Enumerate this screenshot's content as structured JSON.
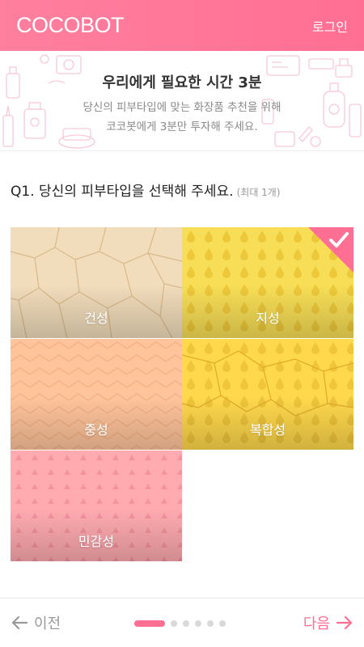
{
  "header": {
    "logo": "COCOBOT",
    "login_label": "로그인"
  },
  "banner": {
    "title": "우리에게 필요한 시간 3분",
    "subtitle_line1": "당신의 피부타입에 맞는 화장품 추천을 위해",
    "subtitle_line2": "코코봇에게 3분만 투자해 주세요."
  },
  "question": {
    "text": "Q1. 당신의 피부타입을 선택해 주세요.",
    "hint": "(최대 1개)"
  },
  "skin_types": [
    {
      "label": "건성",
      "selected": false,
      "color": "#f1dcbb"
    },
    {
      "label": "지성",
      "selected": true,
      "color": "#f7de56"
    },
    {
      "label": "중성",
      "selected": false,
      "color": "#ffc49b"
    },
    {
      "label": "복합성",
      "selected": false,
      "color": "#ffd84c"
    },
    {
      "label": "민감성",
      "selected": false,
      "color": "#ffabb0"
    }
  ],
  "footer": {
    "prev_label": "이전",
    "next_label": "다음",
    "page_count": 6,
    "current_page": 1
  },
  "colors": {
    "accent": "#ff6f93",
    "muted": "#9a9a9a"
  }
}
